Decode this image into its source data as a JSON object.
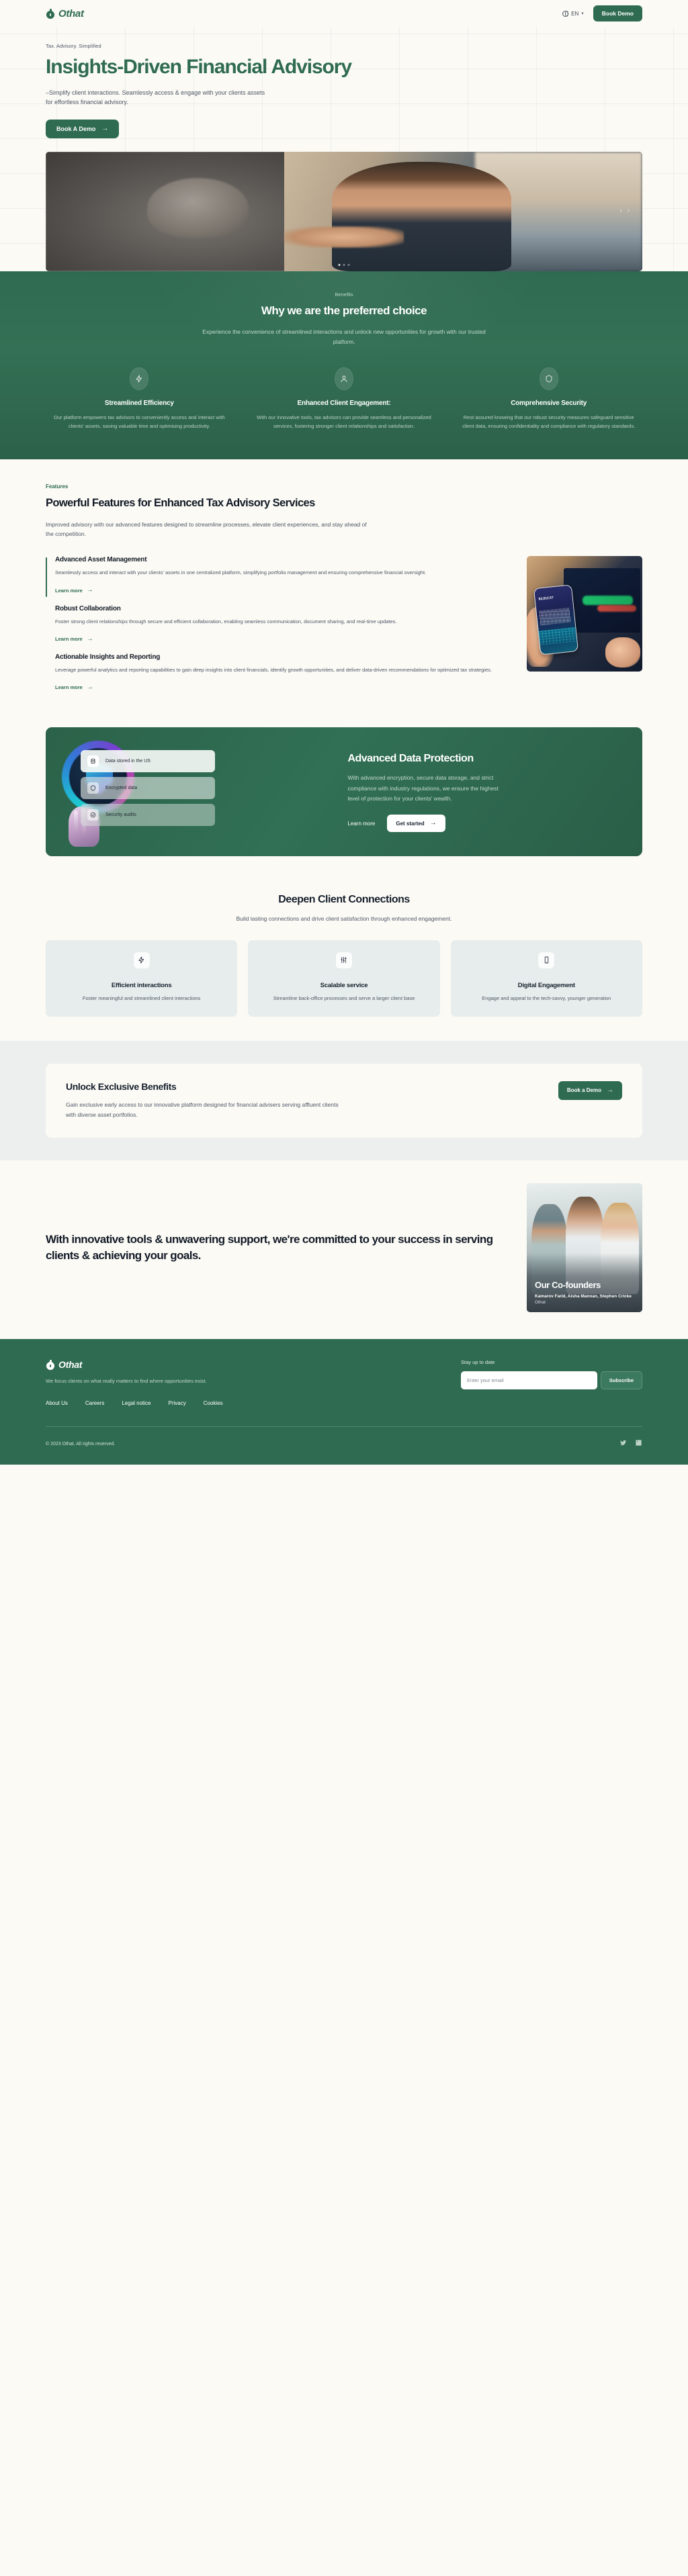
{
  "brand": {
    "name": "Othat",
    "logo_icon": "othat-balloon-logo"
  },
  "header": {
    "lang": "EN",
    "lang_icon": "globe-icon",
    "chevron_icon": "chevron-down-icon",
    "cta": "Book Demo"
  },
  "hero": {
    "eyebrow": "Tax. Advisory. Simplified",
    "title": "Insights-Driven Financial Advisory",
    "body": "–Simplify client interactions. Seamlessly access & engage with your clients assets for effortless financial advisory.",
    "cta": "Book A Demo",
    "cta_arrow": "arrow-right-icon",
    "photo_alt": "handshake-advisor-photo"
  },
  "benefits": {
    "label": "Benefits",
    "title": "Why we are the preferred choice",
    "subtitle": "Experience the convenience of streamlined interactions and unlock new opportunities for growth with our trusted platform.",
    "cards": [
      {
        "icon": "lightning-bolt-icon",
        "title": "Streamlined Efficiency",
        "body": "Our platform empowers tax advisors to conveniently access and interact with clients' assets, saving valuable time and optimising productivity."
      },
      {
        "icon": "user-person-icon",
        "title": "Enhanced Client Engagement:",
        "body": "With our innovative tools, tax advisors can provide seamless and personalized services, fostering stronger client relationships and satisfaction."
      },
      {
        "icon": "shield-icon",
        "title": "Comprehensive Security",
        "body": "Rest assured knowing that our robust security measures safeguard sensitive client data, ensuring confidentiality and compliance with regulatory standards."
      }
    ]
  },
  "features": {
    "label": "Features",
    "title": "Powerful Features for Enhanced Tax Advisory Services",
    "subtitle": "Improved advisory with our advanced features designed to streamline processes, elevate client experiences, and stay ahead of the competition.",
    "learn_more": "Learn more",
    "learn_more_arrow": "arrow-right-icon",
    "photo_alt": "phone-trading-chart-photo",
    "items": [
      {
        "title": "Advanced Asset Management",
        "body": "Seamlessly access and interact with your clients' assets in one centralized platform, simplifying portfolio management and ensuring comprehensive financial oversight."
      },
      {
        "title": "Robust Collaboration",
        "body": "Foster strong client relationships through secure and efficient collaboration, enabling seamless communication, document sharing, and real-time updates."
      },
      {
        "title": "Actionable Insights and Reporting",
        "body": "Leverage powerful analytics and reporting capabilities to gain deep insights into client financials, identify growth opportunities, and deliver data-driven recommendations for optimized tax strategies."
      }
    ]
  },
  "data_protection": {
    "title": "Advanced Data Protection",
    "body": "With advanced encryption, secure data storage, and strict compliance with industry regulations, we ensure the highest level of protection for your clients' wealth.",
    "link": "Learn more",
    "cta": "Get started",
    "cta_arrow": "arrow-right-icon",
    "chips": [
      {
        "icon": "database-icon",
        "label": "Data stored in the US"
      },
      {
        "icon": "shield-icon",
        "label": "Encrypted data"
      },
      {
        "icon": "check-circle-icon",
        "label": "Security audits"
      }
    ]
  },
  "connections": {
    "title": "Deepen Client Connections",
    "subtitle": "Build lasting connections and drive client satisfaction through enhanced engagement.",
    "cards": [
      {
        "icon": "lightning-bolt-icon",
        "title": "Efficient interactions",
        "body": "Foster meaningful and streamlined client interactions"
      },
      {
        "icon": "sliders-icon",
        "title": "Scalable service",
        "body": "Streamline back-office processes and serve a larger client base"
      },
      {
        "icon": "mobile-phone-icon",
        "title": "Digital Engagement",
        "body": "Engage and appeal to the tech-savvy, younger generation"
      }
    ]
  },
  "unlock": {
    "title": "Unlock Exclusive Benefits",
    "body": "Gain exclusive early access to our innovative platform designed for financial advisers serving affluent clients with diverse asset portfolios.",
    "cta": "Book a Demo",
    "cta_arrow": "arrow-right-icon"
  },
  "founders": {
    "statement": "With innovative tools & unwavering support, we're committed to your success in serving clients & achieving your goals.",
    "overlay_title": "Our Co-founders",
    "names": "Kamarov Farid, Aisha Mannan, Stephen Cricke",
    "org": "Othat",
    "photo_alt": "three-cofounders-photo"
  },
  "footer": {
    "tagline": "We focus clients on what really matters to find where opportunities exist.",
    "links": [
      "About Us",
      "Careers",
      "Legal notice",
      "Privacy",
      "Cookies"
    ],
    "newsletter": {
      "label": "Stay up to date",
      "placeholder": "Enter your email",
      "value": "",
      "button": "Subscribe"
    },
    "copyright": "© 2023 Othat. All rights reserved.",
    "socials": [
      {
        "icon": "twitter-icon"
      },
      {
        "icon": "linkedin-icon"
      }
    ]
  },
  "colors": {
    "brand_green": "#2f6b51",
    "page_bg": "#fbfaf5",
    "band_bg": "#ecefee",
    "card_bg": "#e7edec",
    "text_dark": "#121a26",
    "text_muted": "#4d5665"
  }
}
